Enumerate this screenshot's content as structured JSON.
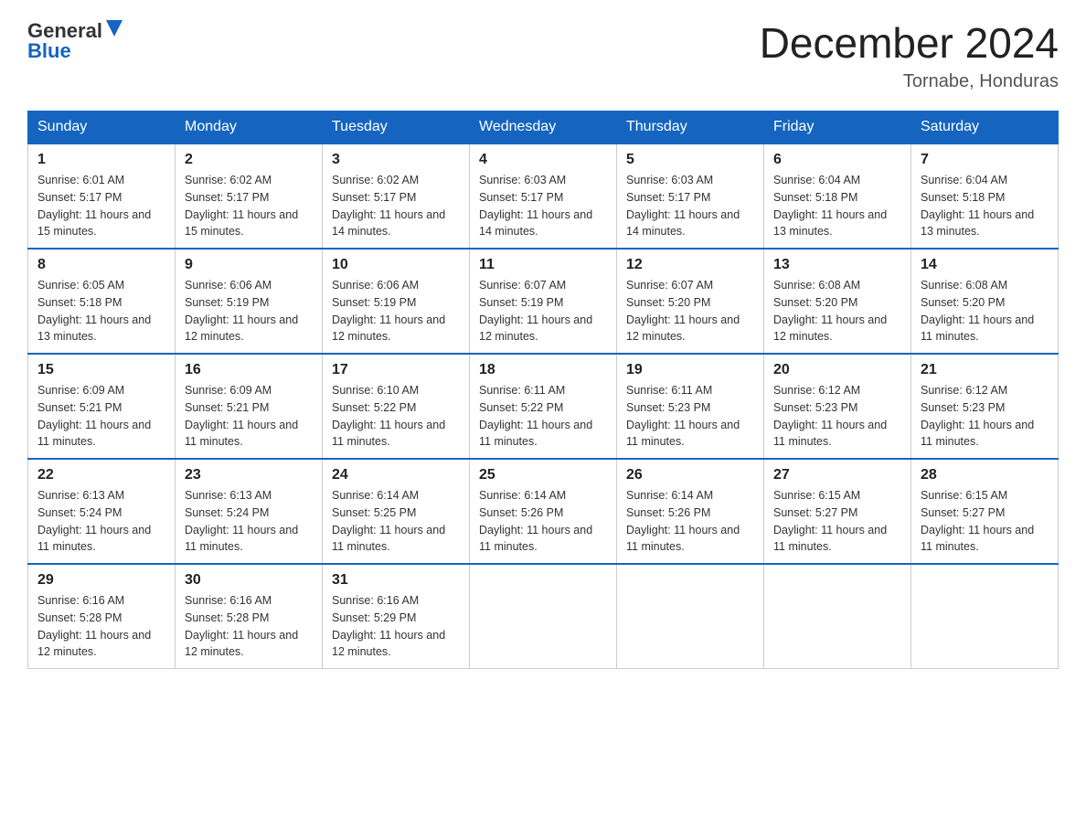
{
  "header": {
    "logo_general": "General",
    "logo_blue": "Blue",
    "title": "December 2024",
    "subtitle": "Tornabe, Honduras"
  },
  "days_of_week": [
    "Sunday",
    "Monday",
    "Tuesday",
    "Wednesday",
    "Thursday",
    "Friday",
    "Saturday"
  ],
  "weeks": [
    [
      {
        "day": "1",
        "sunrise": "Sunrise: 6:01 AM",
        "sunset": "Sunset: 5:17 PM",
        "daylight": "Daylight: 11 hours and 15 minutes."
      },
      {
        "day": "2",
        "sunrise": "Sunrise: 6:02 AM",
        "sunset": "Sunset: 5:17 PM",
        "daylight": "Daylight: 11 hours and 15 minutes."
      },
      {
        "day": "3",
        "sunrise": "Sunrise: 6:02 AM",
        "sunset": "Sunset: 5:17 PM",
        "daylight": "Daylight: 11 hours and 14 minutes."
      },
      {
        "day": "4",
        "sunrise": "Sunrise: 6:03 AM",
        "sunset": "Sunset: 5:17 PM",
        "daylight": "Daylight: 11 hours and 14 minutes."
      },
      {
        "day": "5",
        "sunrise": "Sunrise: 6:03 AM",
        "sunset": "Sunset: 5:17 PM",
        "daylight": "Daylight: 11 hours and 14 minutes."
      },
      {
        "day": "6",
        "sunrise": "Sunrise: 6:04 AM",
        "sunset": "Sunset: 5:18 PM",
        "daylight": "Daylight: 11 hours and 13 minutes."
      },
      {
        "day": "7",
        "sunrise": "Sunrise: 6:04 AM",
        "sunset": "Sunset: 5:18 PM",
        "daylight": "Daylight: 11 hours and 13 minutes."
      }
    ],
    [
      {
        "day": "8",
        "sunrise": "Sunrise: 6:05 AM",
        "sunset": "Sunset: 5:18 PM",
        "daylight": "Daylight: 11 hours and 13 minutes."
      },
      {
        "day": "9",
        "sunrise": "Sunrise: 6:06 AM",
        "sunset": "Sunset: 5:19 PM",
        "daylight": "Daylight: 11 hours and 12 minutes."
      },
      {
        "day": "10",
        "sunrise": "Sunrise: 6:06 AM",
        "sunset": "Sunset: 5:19 PM",
        "daylight": "Daylight: 11 hours and 12 minutes."
      },
      {
        "day": "11",
        "sunrise": "Sunrise: 6:07 AM",
        "sunset": "Sunset: 5:19 PM",
        "daylight": "Daylight: 11 hours and 12 minutes."
      },
      {
        "day": "12",
        "sunrise": "Sunrise: 6:07 AM",
        "sunset": "Sunset: 5:20 PM",
        "daylight": "Daylight: 11 hours and 12 minutes."
      },
      {
        "day": "13",
        "sunrise": "Sunrise: 6:08 AM",
        "sunset": "Sunset: 5:20 PM",
        "daylight": "Daylight: 11 hours and 12 minutes."
      },
      {
        "day": "14",
        "sunrise": "Sunrise: 6:08 AM",
        "sunset": "Sunset: 5:20 PM",
        "daylight": "Daylight: 11 hours and 11 minutes."
      }
    ],
    [
      {
        "day": "15",
        "sunrise": "Sunrise: 6:09 AM",
        "sunset": "Sunset: 5:21 PM",
        "daylight": "Daylight: 11 hours and 11 minutes."
      },
      {
        "day": "16",
        "sunrise": "Sunrise: 6:09 AM",
        "sunset": "Sunset: 5:21 PM",
        "daylight": "Daylight: 11 hours and 11 minutes."
      },
      {
        "day": "17",
        "sunrise": "Sunrise: 6:10 AM",
        "sunset": "Sunset: 5:22 PM",
        "daylight": "Daylight: 11 hours and 11 minutes."
      },
      {
        "day": "18",
        "sunrise": "Sunrise: 6:11 AM",
        "sunset": "Sunset: 5:22 PM",
        "daylight": "Daylight: 11 hours and 11 minutes."
      },
      {
        "day": "19",
        "sunrise": "Sunrise: 6:11 AM",
        "sunset": "Sunset: 5:23 PM",
        "daylight": "Daylight: 11 hours and 11 minutes."
      },
      {
        "day": "20",
        "sunrise": "Sunrise: 6:12 AM",
        "sunset": "Sunset: 5:23 PM",
        "daylight": "Daylight: 11 hours and 11 minutes."
      },
      {
        "day": "21",
        "sunrise": "Sunrise: 6:12 AM",
        "sunset": "Sunset: 5:23 PM",
        "daylight": "Daylight: 11 hours and 11 minutes."
      }
    ],
    [
      {
        "day": "22",
        "sunrise": "Sunrise: 6:13 AM",
        "sunset": "Sunset: 5:24 PM",
        "daylight": "Daylight: 11 hours and 11 minutes."
      },
      {
        "day": "23",
        "sunrise": "Sunrise: 6:13 AM",
        "sunset": "Sunset: 5:24 PM",
        "daylight": "Daylight: 11 hours and 11 minutes."
      },
      {
        "day": "24",
        "sunrise": "Sunrise: 6:14 AM",
        "sunset": "Sunset: 5:25 PM",
        "daylight": "Daylight: 11 hours and 11 minutes."
      },
      {
        "day": "25",
        "sunrise": "Sunrise: 6:14 AM",
        "sunset": "Sunset: 5:26 PM",
        "daylight": "Daylight: 11 hours and 11 minutes."
      },
      {
        "day": "26",
        "sunrise": "Sunrise: 6:14 AM",
        "sunset": "Sunset: 5:26 PM",
        "daylight": "Daylight: 11 hours and 11 minutes."
      },
      {
        "day": "27",
        "sunrise": "Sunrise: 6:15 AM",
        "sunset": "Sunset: 5:27 PM",
        "daylight": "Daylight: 11 hours and 11 minutes."
      },
      {
        "day": "28",
        "sunrise": "Sunrise: 6:15 AM",
        "sunset": "Sunset: 5:27 PM",
        "daylight": "Daylight: 11 hours and 11 minutes."
      }
    ],
    [
      {
        "day": "29",
        "sunrise": "Sunrise: 6:16 AM",
        "sunset": "Sunset: 5:28 PM",
        "daylight": "Daylight: 11 hours and 12 minutes."
      },
      {
        "day": "30",
        "sunrise": "Sunrise: 6:16 AM",
        "sunset": "Sunset: 5:28 PM",
        "daylight": "Daylight: 11 hours and 12 minutes."
      },
      {
        "day": "31",
        "sunrise": "Sunrise: 6:16 AM",
        "sunset": "Sunset: 5:29 PM",
        "daylight": "Daylight: 11 hours and 12 minutes."
      },
      null,
      null,
      null,
      null
    ]
  ]
}
